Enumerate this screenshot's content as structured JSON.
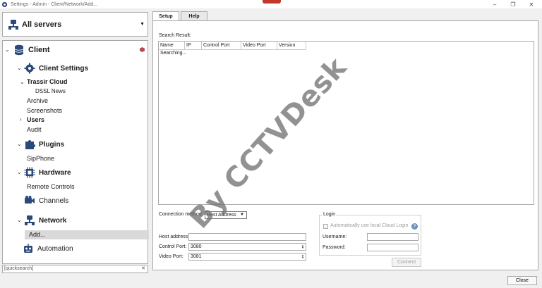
{
  "window": {
    "title": "Settings - Admin - Client/Network/Add...",
    "controls": {
      "minimize": "–",
      "restore": "❐",
      "close": "✕"
    }
  },
  "servers": {
    "label": "All servers"
  },
  "tree": {
    "client": "Client",
    "client_settings": "Client Settings",
    "trassir_cloud": "Trassir Cloud",
    "dssl_news": "DSSL News",
    "archive": "Archive",
    "screenshots": "Screenshots",
    "users": "Users",
    "audit": "Audit",
    "plugins": "Plugins",
    "sipphone": "SipPhone",
    "hardware": "Hardware",
    "remote_controls": "Remote Controls",
    "channels": "Channels",
    "network": "Network",
    "add": "Add...",
    "automation": "Automation"
  },
  "quicksearch": {
    "placeholder": "[quicksearch]",
    "clear": "✕"
  },
  "tabs": [
    {
      "label": "Setup",
      "active": true
    },
    {
      "label": "Help",
      "active": false
    }
  ],
  "search": {
    "label": "Search Result:",
    "columns": [
      "Name",
      "IP",
      "Control Port",
      "Video Port",
      "Version"
    ],
    "status": "Searching..."
  },
  "connection": {
    "method_label": "Connection method:",
    "method_value": "Host Address",
    "host_label": "Host address:",
    "host_value": "",
    "control_port_label": "Control Port:",
    "control_port_value": "3080",
    "video_port_label": "Video Port:",
    "video_port_value": "3081"
  },
  "login": {
    "legend": "Login",
    "auto_cloud_label": "Automatically use local Cloud Login",
    "username_label": "Username:",
    "password_label": "Password:",
    "help": "?"
  },
  "buttons": {
    "connect": "Connect",
    "close": "Close"
  },
  "watermark": "By CCTVDesk",
  "colors": {
    "selected_row": "#d9d9d9",
    "border": "#a9a9a9",
    "accent_logo": "#c0392b"
  }
}
